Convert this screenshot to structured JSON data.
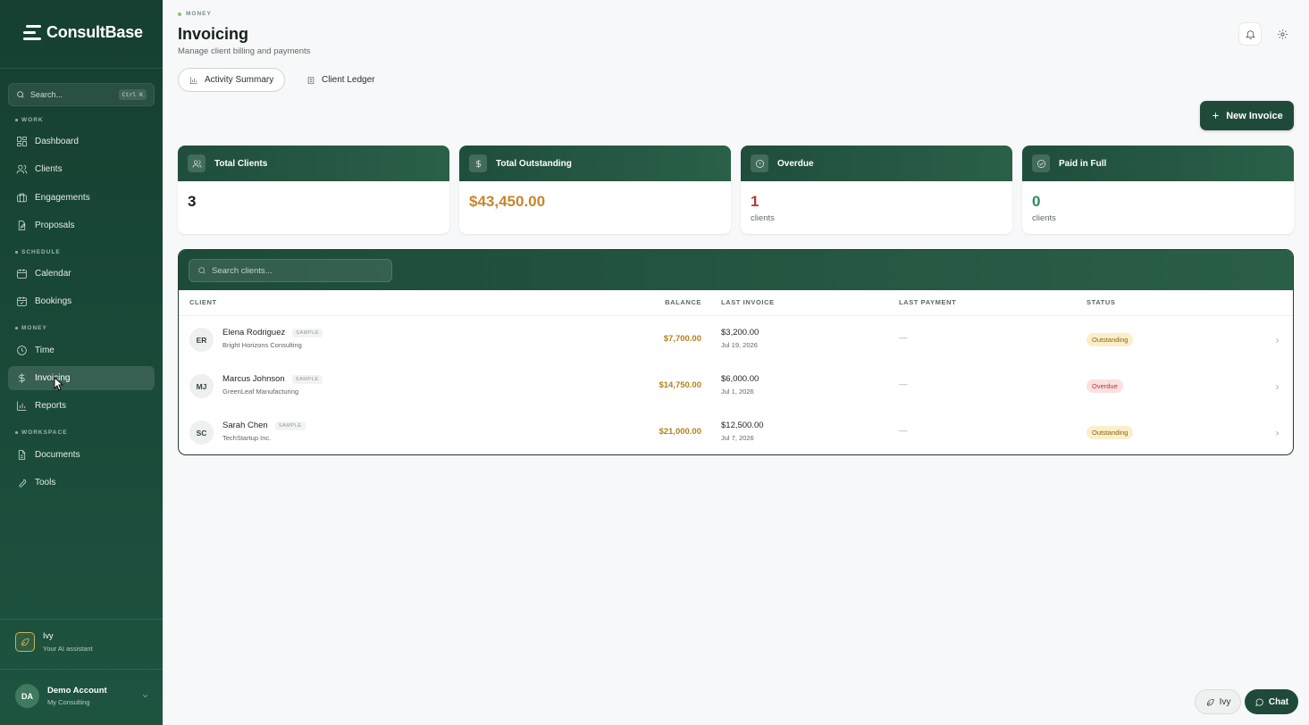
{
  "app": {
    "name": "ConsultBase"
  },
  "sidebar": {
    "search_placeholder": "Search...",
    "search_shortcut": "Ctrl K",
    "sections": {
      "work": "WORK",
      "schedule": "SCHEDULE",
      "money": "MONEY",
      "workspace": "WORKSPACE"
    },
    "items": [
      {
        "label": "Dashboard",
        "icon": "grid-icon"
      },
      {
        "label": "Clients",
        "icon": "users-icon"
      },
      {
        "label": "Engagements",
        "icon": "briefcase-icon"
      },
      {
        "label": "Proposals",
        "icon": "file-edit-icon"
      },
      {
        "label": "Calendar",
        "icon": "calendar-icon"
      },
      {
        "label": "Bookings",
        "icon": "calendar-check-icon"
      },
      {
        "label": "Time",
        "icon": "clock-icon"
      },
      {
        "label": "Invoicing",
        "icon": "dollar-icon",
        "active": true
      },
      {
        "label": "Reports",
        "icon": "bar-chart-icon"
      },
      {
        "label": "Documents",
        "icon": "document-icon"
      },
      {
        "label": "Tools",
        "icon": "wrench-icon"
      }
    ],
    "assistant": {
      "name": "Ivy",
      "subtitle": "Your AI assistant"
    },
    "account": {
      "initials": "DA",
      "name": "Demo Account",
      "org": "My Consulting"
    }
  },
  "header": {
    "breadcrumb": "MONEY",
    "title": "Invoicing",
    "subtitle": "Manage client billing and payments"
  },
  "tabs": [
    {
      "label": "Activity Summary",
      "active": true
    },
    {
      "label": "Client Ledger",
      "active": false
    }
  ],
  "actions": {
    "new_invoice": "New Invoice"
  },
  "stats": [
    {
      "label": "Total Clients",
      "value": "3",
      "unit": "",
      "color": "#16211c"
    },
    {
      "label": "Total Outstanding",
      "value": "$43,450.00",
      "unit": "",
      "color": "#c9862a"
    },
    {
      "label": "Overdue",
      "value": "1",
      "unit": "clients",
      "color": "#b13a3a"
    },
    {
      "label": "Paid in Full",
      "value": "0",
      "unit": "clients",
      "color": "#2f8a5c"
    }
  ],
  "table": {
    "search_placeholder": "Search clients...",
    "columns": [
      "CLIENT",
      "BALANCE",
      "LAST INVOICE",
      "LAST PAYMENT",
      "STATUS"
    ],
    "sample_badge": "SAMPLE",
    "rows": [
      {
        "initials": "ER",
        "name": "Elena Rodriguez",
        "company": "Bright Horizons Consulting",
        "balance": "$7,700.00",
        "last_invoice_amount": "$3,200.00",
        "last_invoice_date": "Jul 19, 2026",
        "last_payment": "—",
        "status": "Outstanding"
      },
      {
        "initials": "MJ",
        "name": "Marcus Johnson",
        "company": "GreenLeaf Manufacturing",
        "balance": "$14,750.00",
        "last_invoice_amount": "$6,000.00",
        "last_invoice_date": "Jul 1, 2026",
        "last_payment": "—",
        "status": "Overdue"
      },
      {
        "initials": "SC",
        "name": "Sarah Chen",
        "company": "TechStartup Inc.",
        "balance": "$21,000.00",
        "last_invoice_amount": "$12,500.00",
        "last_invoice_date": "Jul 7, 2026",
        "last_payment": "—",
        "status": "Outstanding"
      }
    ]
  },
  "floating": {
    "ivy": "Ivy",
    "chat": "Chat"
  }
}
